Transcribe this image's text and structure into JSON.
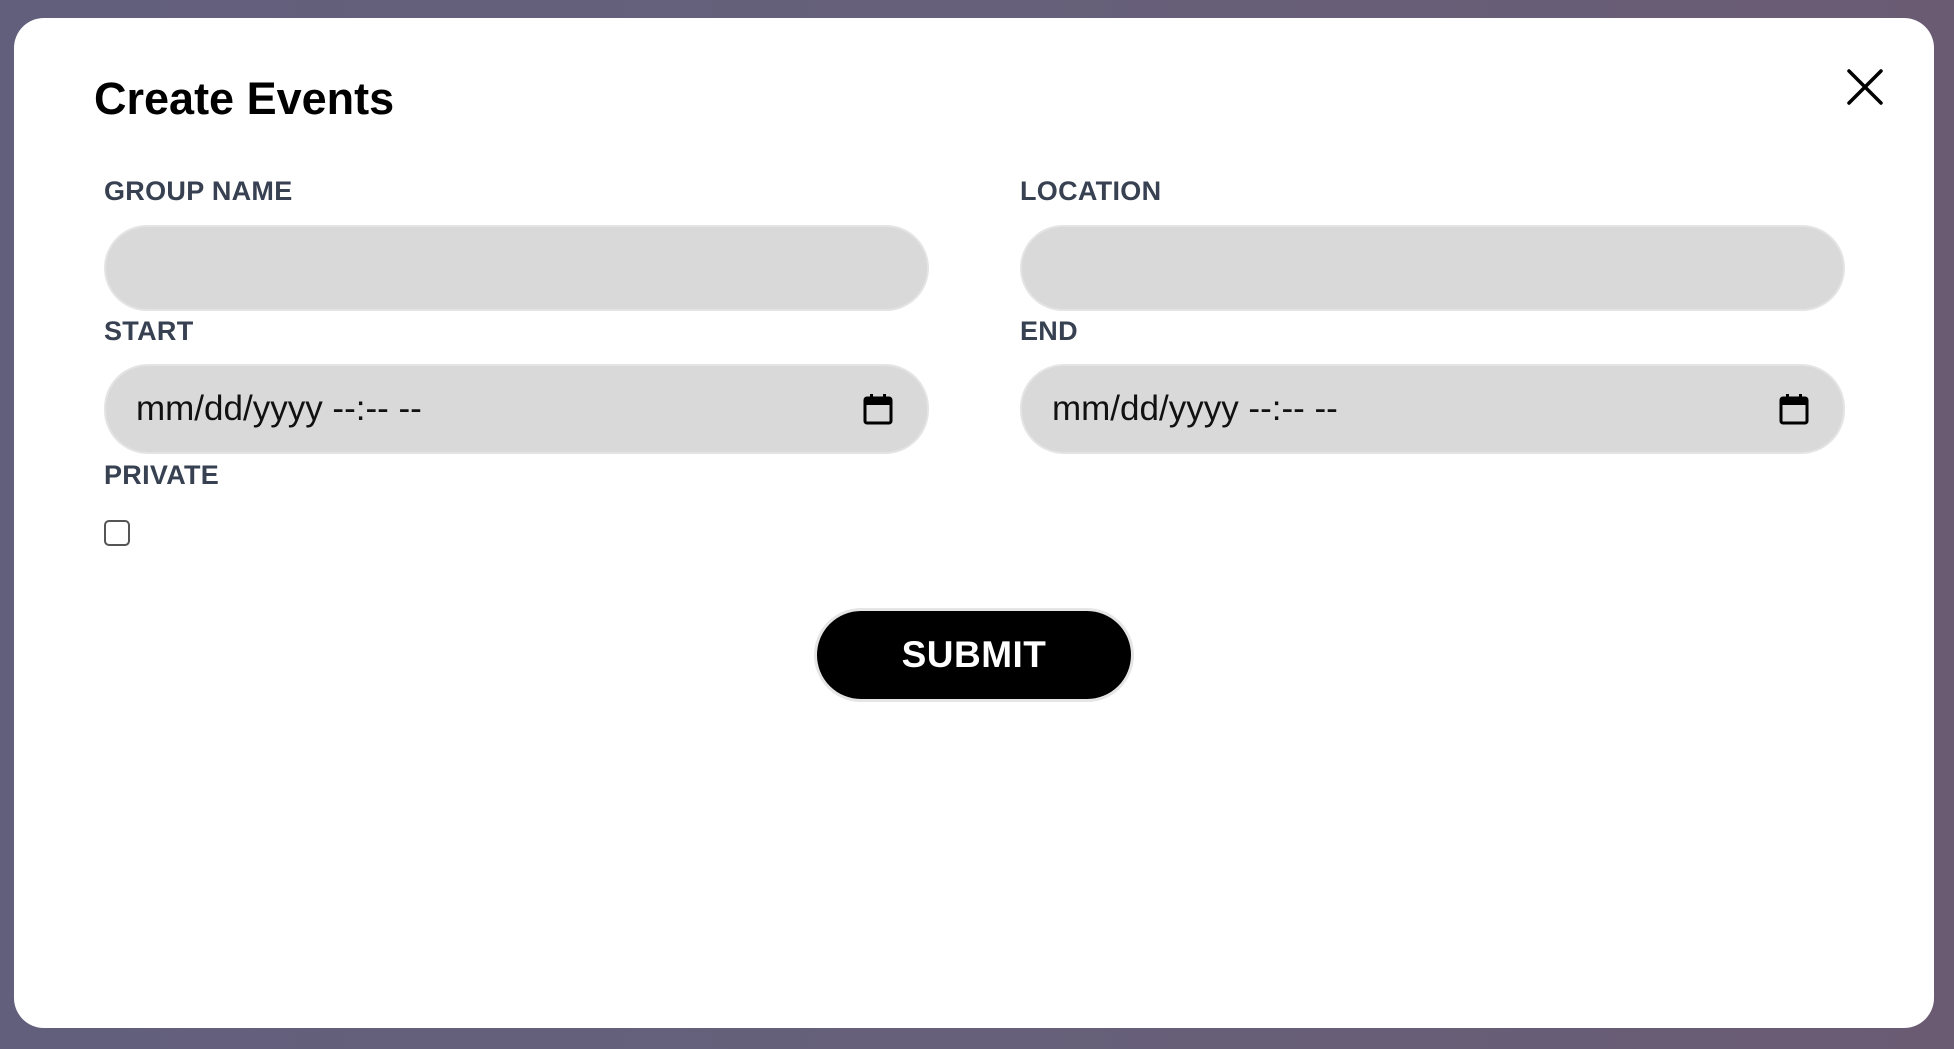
{
  "modal": {
    "title": "Create Events",
    "close_icon": "close-icon"
  },
  "fields": {
    "group_name": {
      "label": "GROUP NAME",
      "value": ""
    },
    "location": {
      "label": "LOCATION",
      "value": ""
    },
    "start": {
      "label": "START",
      "placeholder": "mm/dd/yyyy --:-- --",
      "icon": "calendar-icon"
    },
    "end": {
      "label": "END",
      "placeholder": "mm/dd/yyyy --:-- --",
      "icon": "calendar-icon"
    },
    "private": {
      "label": "PRIVATE",
      "checked": false
    }
  },
  "submit": {
    "label": "SUBMIT"
  },
  "colors": {
    "backdrop": "#66607a",
    "input_bg": "#d9d9d9",
    "label_text": "#374151",
    "button_bg": "#000000",
    "button_text": "#ffffff"
  }
}
